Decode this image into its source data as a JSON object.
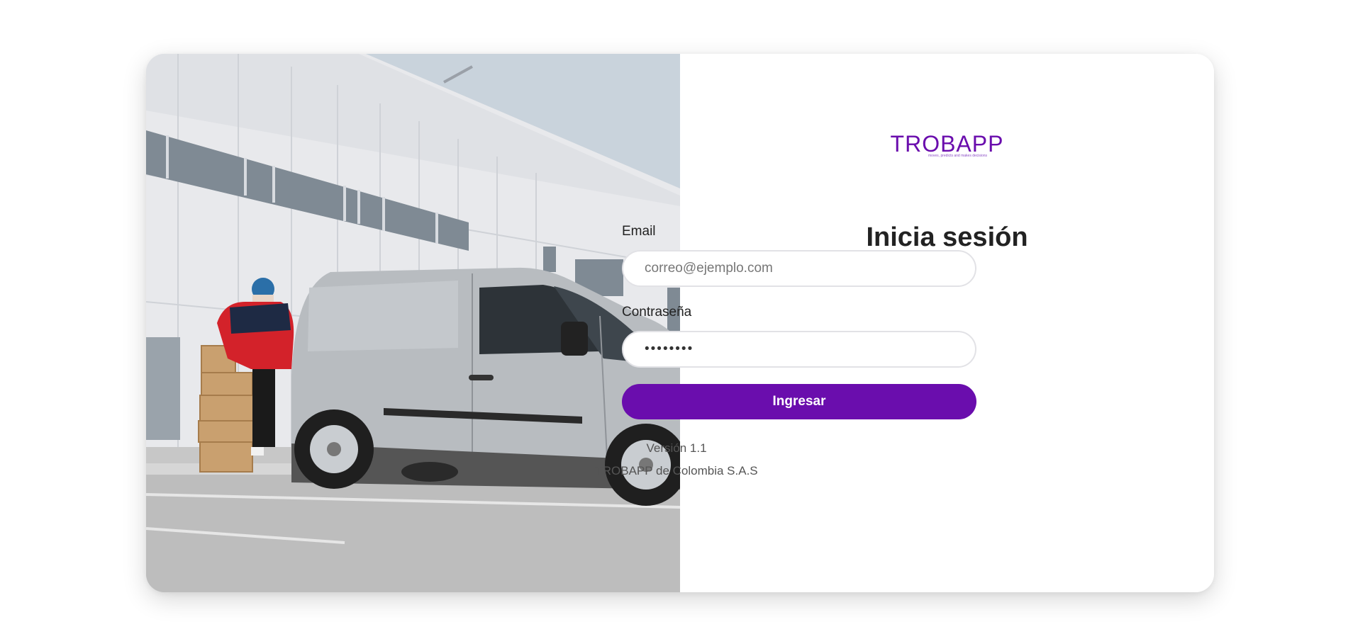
{
  "logo": {
    "wordmark": "TROBAPP",
    "tagline": "moves, predicts and makes decisions"
  },
  "login": {
    "title": "Inicia sesión",
    "email_label": "Email",
    "email_placeholder": "correo@ejemplo.com",
    "password_label": "Contraseña",
    "password_value": "••••••••",
    "submit_label": "Ingresar"
  },
  "footer": {
    "version": "Versión 1.1",
    "company": "TROBAPP de Colombia S.A.S"
  },
  "colors": {
    "brand": "#6a0dad"
  },
  "image": {
    "description_icon": "delivery-van-photo"
  }
}
